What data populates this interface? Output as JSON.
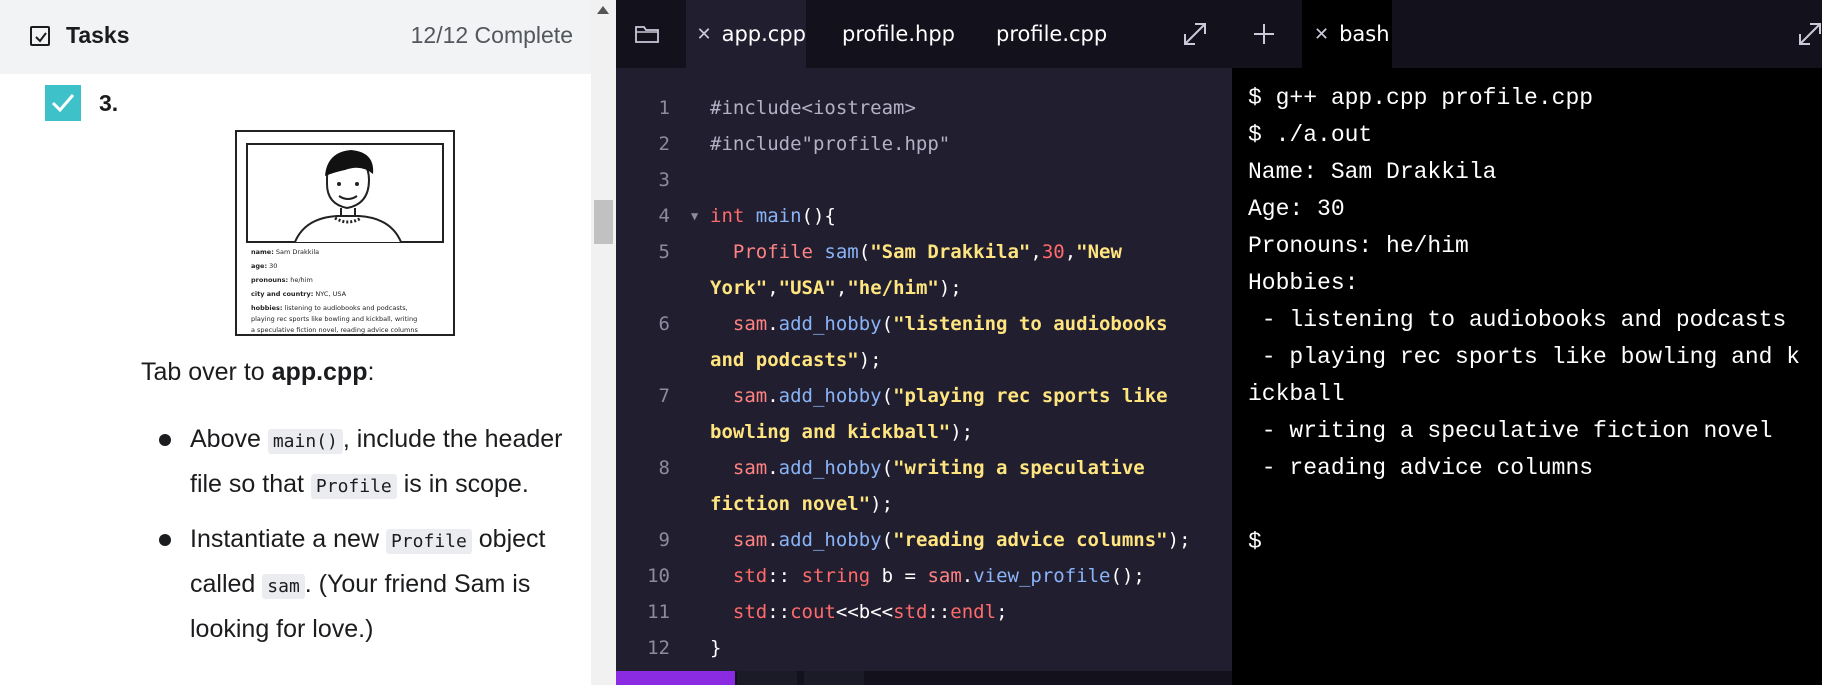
{
  "tasks": {
    "title": "Tasks",
    "progress": "12/12 Complete",
    "step_number": "3.",
    "card": {
      "name_label": "name:",
      "name_value": "Sam Drakkila",
      "age_label": "age:",
      "age_value": "30",
      "pronouns_label": "pronouns:",
      "pronouns_value": "he/him",
      "city_label": "city and country:",
      "city_value": "NYC, USA",
      "hobbies_label": "hobbies:",
      "hobbies_line1": "listening to audiobooks and podcasts,",
      "hobbies_line2": "playing rec sports like bowling and kickball, writing",
      "hobbies_line3": "a speculative fiction novel, reading advice columns"
    },
    "instruction_prefix": "Tab over to ",
    "instruction_file": "app.cpp",
    "instruction_suffix": ":",
    "bullets": [
      {
        "pre": "Above ",
        "code": "main()",
        "mid": ", include the header file so that ",
        "code2": "Profile",
        "post": " is in scope."
      },
      {
        "pre": "Instantiate a new ",
        "code": "Profile",
        "mid": " object called ",
        "code2": "sam",
        "post": ". (Your friend Sam is looking for love.)"
      }
    ]
  },
  "editor": {
    "tabs": [
      {
        "label": "app.cpp",
        "active": true
      },
      {
        "label": "profile.hpp",
        "active": false
      },
      {
        "label": "profile.cpp",
        "active": false
      }
    ],
    "line_numbers": [
      "1",
      "2",
      "3",
      "4",
      "5",
      "6",
      "7",
      "8",
      "9",
      "10",
      "11",
      "12"
    ]
  },
  "terminal": {
    "tab_label": "bash",
    "lines": [
      "$ g++ app.cpp profile.cpp",
      "$ ./a.out",
      "Name: Sam Drakkila",
      "Age: 30",
      "Pronouns: he/him",
      "Hobbies:",
      " - listening to audiobooks and podcasts",
      " - playing rec sports like bowling and k",
      "ickball",
      " - writing a speculative fiction novel",
      " - reading advice columns",
      "",
      "$"
    ]
  },
  "colors": {
    "accent_purple": "#8a2be2",
    "check_teal": "#3fc1c9",
    "editor_bg": "#211e2f"
  }
}
